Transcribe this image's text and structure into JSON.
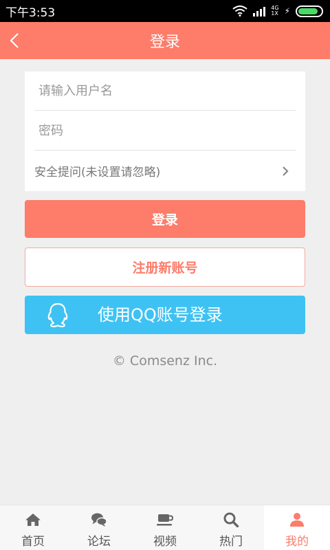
{
  "status_bar": {
    "time": "下午3:53",
    "network_top": "4G",
    "network_bottom": "1X"
  },
  "header": {
    "title": "登录"
  },
  "form": {
    "username_placeholder": "请输入用户名",
    "password_placeholder": "密码",
    "security_label": "安全提问(未设置请忽略)"
  },
  "buttons": {
    "login": "登录",
    "register": "注册新账号",
    "qq_login": "使用QQ账号登录"
  },
  "copyright": "© Comsenz Inc.",
  "bottom_nav": {
    "items": [
      {
        "label": "首页",
        "icon": "home-icon"
      },
      {
        "label": "论坛",
        "icon": "chat-bubbles-icon"
      },
      {
        "label": "视频",
        "icon": "coffee-cup-icon"
      },
      {
        "label": "热门",
        "icon": "search-icon"
      },
      {
        "label": "我的",
        "icon": "user-icon"
      }
    ],
    "active_index": 4
  },
  "colors": {
    "accent": "#fd7c6a",
    "qq_blue": "#3ec2f3",
    "background": "#efefef"
  }
}
